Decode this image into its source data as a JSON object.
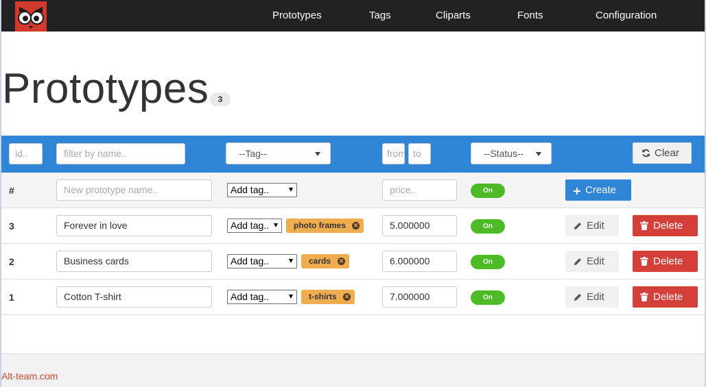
{
  "nav": {
    "items": [
      "Prototypes",
      "Tags",
      "Cliparts",
      "Fonts",
      "Configuration"
    ]
  },
  "page": {
    "title": "Prototypes",
    "count": "3"
  },
  "filters": {
    "id_placeholder": "id..",
    "name_placeholder": "filter by name..",
    "tag_select": "--Tag--",
    "price_from_placeholder": "from",
    "price_to_placeholder": "to",
    "status_select": "--Status--",
    "clear_label": "Clear"
  },
  "new_row": {
    "id_header": "#",
    "name_placeholder": "New prototype name..",
    "tag_select": "Add tag..",
    "price_placeholder": "price..",
    "status": "On",
    "create_label": "Create"
  },
  "rows": [
    {
      "id": "3",
      "name": "Forever in love",
      "tag_select": "Add tag..",
      "tag": "photo frames",
      "price": "5.000000",
      "status": "On",
      "edit_label": "Edit",
      "delete_label": "Delete"
    },
    {
      "id": "2",
      "name": "Business cards",
      "tag_select": "Add tag..",
      "tag": "cards",
      "price": "6.000000",
      "status": "On",
      "edit_label": "Edit",
      "delete_label": "Delete"
    },
    {
      "id": "1",
      "name": "Cotton T-shirt",
      "tag_select": "Add tag..",
      "tag": "t-shirts",
      "price": "7.000000",
      "status": "On",
      "edit_label": "Edit",
      "delete_label": "Delete"
    }
  ],
  "footer": {
    "link": "Alt-team.com"
  },
  "colors": {
    "navbar": "#222222",
    "accent_blue": "#2f85d6",
    "tag_orange": "#f0ad4e",
    "toggle_green": "#4cbb25",
    "delete_red": "#d43f3a",
    "logo_red": "#d23a2d"
  },
  "icons": {
    "logo": "owl-logo-icon",
    "clear": "refresh-icon",
    "create": "plus-icon",
    "edit": "pencil-icon",
    "delete": "trash-icon",
    "tag_remove": "close-circle-icon"
  }
}
